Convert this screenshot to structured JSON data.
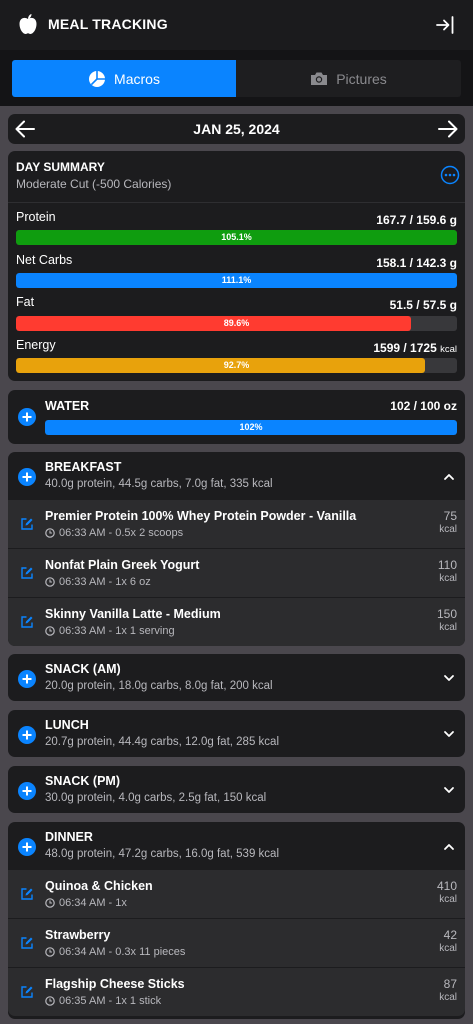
{
  "app": {
    "title": "MEAL TRACKING",
    "icon": "apple-icon",
    "exit_icon": "exit-icon"
  },
  "tabs": [
    {
      "label": "Macros",
      "icon": "pie-chart-icon",
      "active": true
    },
    {
      "label": "Pictures",
      "icon": "camera-icon",
      "active": false
    }
  ],
  "date": {
    "label": "JAN 25, 2024"
  },
  "summary": {
    "title": "DAY SUMMARY",
    "subtitle": "Moderate Cut (-500 Calories)",
    "macros": [
      {
        "name": "Protein",
        "value": "167.7 / 159.6 g",
        "percent_label": "105.1%",
        "fill": 1.0,
        "color": "#0f9d0f"
      },
      {
        "name": "Net Carbs",
        "value": "158.1 / 142.3 g",
        "percent_label": "111.1%",
        "fill": 1.0,
        "color": "#0a84ff"
      },
      {
        "name": "Fat",
        "value": "51.5 / 57.5 g",
        "percent_label": "89.6%",
        "fill": 0.896,
        "color": "#ff3b30"
      },
      {
        "name": "Energy",
        "value_main": "1599 / 1725",
        "value_unit": "kcal",
        "percent_label": "92.7%",
        "fill": 0.927,
        "color": "#e8a20c"
      }
    ]
  },
  "water": {
    "title": "WATER",
    "value": "102 / 100 oz",
    "percent_label": "102%",
    "fill": 1.0,
    "color": "#0a84ff"
  },
  "meals": {
    "breakfast": {
      "title": "BREAKFAST",
      "summary": "40.0g protein, 44.5g carbs, 7.0g fat, 335 kcal",
      "expanded": true,
      "items": [
        {
          "name": "Premier Protein 100% Whey Protein Powder - Vanilla",
          "meta": "06:33 AM - 0.5x 2 scoops",
          "kcal": "75",
          "unit": "kcal"
        },
        {
          "name": "Nonfat Plain Greek Yogurt",
          "meta": "06:33 AM - 1x 6 oz",
          "kcal": "110",
          "unit": "kcal"
        },
        {
          "name": "Skinny Vanilla Latte - Medium",
          "meta": "06:33 AM - 1x 1 serving",
          "kcal": "150",
          "unit": "kcal"
        }
      ]
    },
    "snack_am": {
      "title": "SNACK (AM)",
      "summary": "20.0g protein, 18.0g carbs, 8.0g fat, 200 kcal",
      "expanded": false
    },
    "lunch": {
      "title": "LUNCH",
      "summary": "20.7g protein, 44.4g carbs, 12.0g fat, 285 kcal",
      "expanded": false
    },
    "snack_pm": {
      "title": "SNACK (PM)",
      "summary": "30.0g protein, 4.0g carbs, 2.5g fat, 150 kcal",
      "expanded": false
    },
    "dinner": {
      "title": "DINNER",
      "summary": "48.0g protein, 47.2g carbs, 16.0g fat, 539 kcal",
      "expanded": true,
      "items": [
        {
          "name": "Quinoa & Chicken",
          "meta": "06:34 AM - 1x",
          "kcal": "410",
          "unit": "kcal"
        },
        {
          "name": "Strawberry",
          "meta": "06:34 AM - 0.3x 11 pieces",
          "kcal": "42",
          "unit": "kcal"
        },
        {
          "name": "Flagship Cheese Sticks",
          "meta": "06:35 AM - 1x 1 stick",
          "kcal": "87",
          "unit": "kcal"
        }
      ]
    }
  },
  "colors": {
    "accent": "#0a84ff",
    "card": "#1c1c1e",
    "item": "#2c2c2e"
  }
}
